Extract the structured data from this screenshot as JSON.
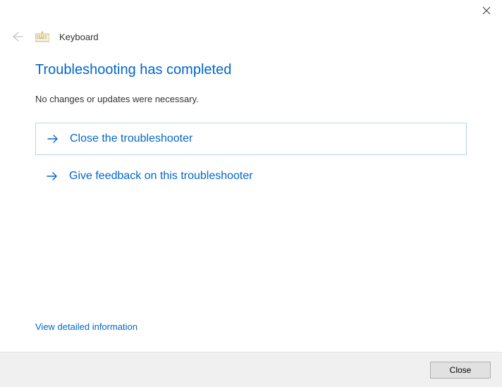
{
  "titlebar": {
    "close_label": "Close"
  },
  "header": {
    "icon": "keyboard-icon",
    "title": "Keyboard"
  },
  "main": {
    "heading": "Troubleshooting has completed",
    "subtext": "No changes or updates were necessary.",
    "options": [
      {
        "label": "Close the troubleshooter"
      },
      {
        "label": "Give feedback on this troubleshooter"
      }
    ],
    "detail_link": "View detailed information"
  },
  "footer": {
    "close_button": "Close"
  }
}
